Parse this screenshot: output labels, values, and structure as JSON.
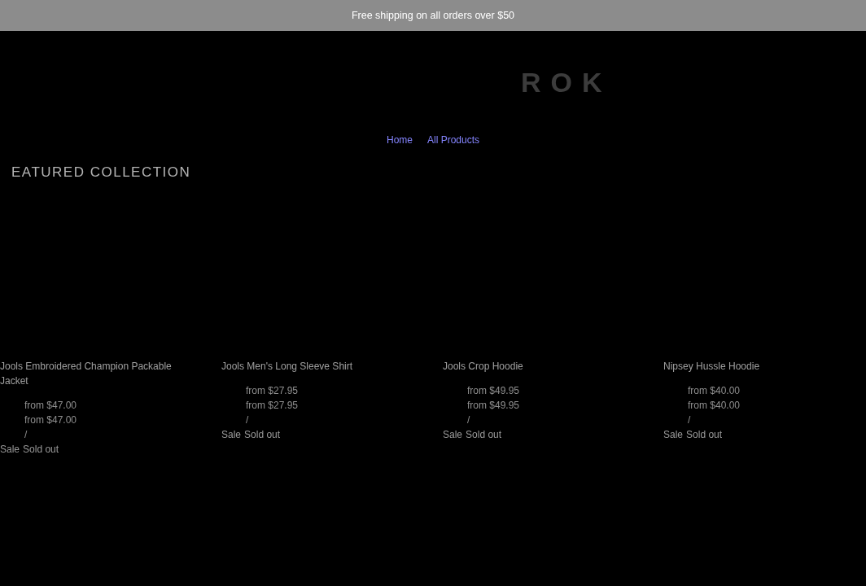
{
  "announcement": {
    "text": "Free shipping on all orders over $50"
  },
  "header": {
    "logo": "ROK",
    "nav": [
      "Home",
      "All Products"
    ]
  },
  "collection": {
    "title": "EATURED COLLECTION",
    "products": [
      {
        "title": "Jools Embroidered Champion Packable Jacket",
        "prices": [
          "from $47.00",
          "from $47.00"
        ],
        "separator": "/",
        "badges": [
          "Sale",
          "Sold out"
        ]
      },
      {
        "title": "Jools Men's Long Sleeve Shirt",
        "prices": [
          "from $27.95",
          "from $27.95"
        ],
        "separator": "/",
        "badges": [
          "Sale",
          "Sold out"
        ]
      },
      {
        "title": "Jools Crop Hoodie",
        "prices": [
          "from $49.95",
          "from $49.95"
        ],
        "separator": "/",
        "badges": [
          "Sale",
          "Sold out"
        ]
      },
      {
        "title": "Nipsey Hussle Hoodie",
        "prices": [
          "from $40.00",
          "from $40.00"
        ],
        "separator": "/",
        "badges": [
          "Sale",
          "Sold out"
        ]
      }
    ]
  }
}
